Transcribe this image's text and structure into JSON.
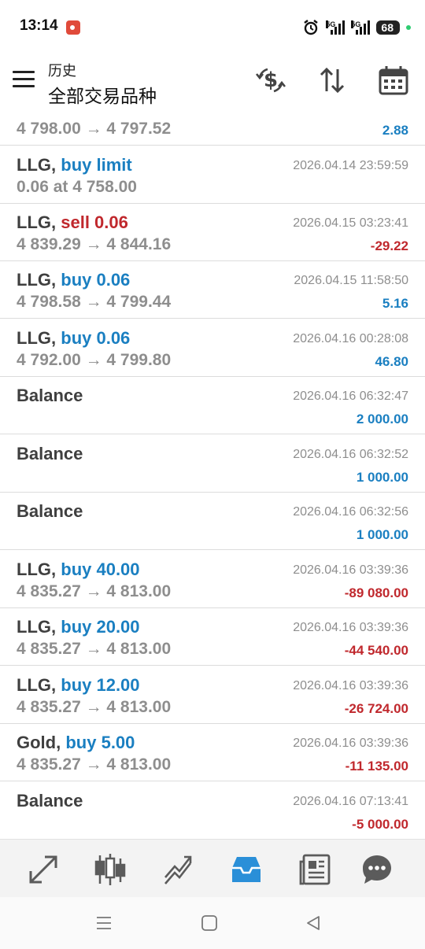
{
  "status": {
    "time": "13:14",
    "network1": "5G",
    "network2": "5G",
    "battery": "68"
  },
  "header": {
    "subtitle": "历史",
    "title": "全部交易品种"
  },
  "rows": [
    {
      "l1_symbol": "",
      "l1_sep": "",
      "l1_action": "",
      "l2": "4 798.00 → 4 797.52",
      "r1": "",
      "r2": "2.88",
      "r2_color": "blue"
    },
    {
      "l1_symbol": "LLG",
      "l1_sep": ",",
      "l1_action": "buy limit",
      "action_color": "blue",
      "l2": "0.06 at 4 758.00",
      "r1": "2026.04.14 23:59:59",
      "r2": "",
      "r2_color": "blue"
    },
    {
      "l1_symbol": "LLG",
      "l1_sep": ",",
      "l1_action": "sell 0.06",
      "action_color": "red",
      "l2": "4 839.29 → 4 844.16",
      "r1": "2026.04.15 03:23:41",
      "r2": "-29.22",
      "r2_color": "red"
    },
    {
      "l1_symbol": "LLG",
      "l1_sep": ",",
      "l1_action": "buy 0.06",
      "action_color": "blue",
      "l2": "4 798.58 → 4 799.44",
      "r1": "2026.04.15 11:58:50",
      "r2": "5.16",
      "r2_color": "blue"
    },
    {
      "l1_symbol": "LLG",
      "l1_sep": ",",
      "l1_action": "buy 0.06",
      "action_color": "blue",
      "l2": "4 792.00 → 4 799.80",
      "r1": "2026.04.16 00:28:08",
      "r2": "46.80",
      "r2_color": "blue"
    },
    {
      "l1_symbol": "Balance",
      "l1_sep": "",
      "l1_action": "",
      "l2": "",
      "r1": "2026.04.16 06:32:47",
      "r2": "2 000.00",
      "r2_color": "blue"
    },
    {
      "l1_symbol": "Balance",
      "l1_sep": "",
      "l1_action": "",
      "l2": "",
      "r1": "2026.04.16 06:32:52",
      "r2": "1 000.00",
      "r2_color": "blue"
    },
    {
      "l1_symbol": "Balance",
      "l1_sep": "",
      "l1_action": "",
      "l2": "",
      "r1": "2026.04.16 06:32:56",
      "r2": "1 000.00",
      "r2_color": "blue"
    },
    {
      "l1_symbol": "LLG",
      "l1_sep": ",",
      "l1_action": "buy 40.00",
      "action_color": "blue",
      "l2": "4 835.27 → 4 813.00",
      "r1": "2026.04.16 03:39:36",
      "r2": "-89 080.00",
      "r2_color": "red"
    },
    {
      "l1_symbol": "LLG",
      "l1_sep": ",",
      "l1_action": "buy 20.00",
      "action_color": "blue",
      "l2": "4 835.27 → 4 813.00",
      "r1": "2026.04.16 03:39:36",
      "r2": "-44 540.00",
      "r2_color": "red"
    },
    {
      "l1_symbol": "LLG",
      "l1_sep": ",",
      "l1_action": "buy 12.00",
      "action_color": "blue",
      "l2": "4 835.27 → 4 813.00",
      "r1": "2026.04.16 03:39:36",
      "r2": "-26 724.00",
      "r2_color": "red"
    },
    {
      "l1_symbol": "Gold",
      "l1_sep": ",",
      "l1_action": "buy 5.00",
      "action_color": "blue",
      "l2": "4 835.27 → 4 813.00",
      "r1": "2026.04.16 03:39:36",
      "r2": "-11 135.00",
      "r2_color": "red"
    },
    {
      "l1_symbol": "Balance",
      "l1_sep": "",
      "l1_action": "",
      "l2": "",
      "r1": "2026.04.16 07:13:41",
      "r2": "-5 000.00",
      "r2_color": "red"
    }
  ],
  "colors": {
    "accent_blue": "#1a7fc1",
    "loss_red": "#c0282d",
    "active_nav": "#2a8fd8"
  },
  "nav": {
    "items": [
      "trade-icon",
      "chart-icon",
      "analytics-icon",
      "history-icon",
      "news-icon",
      "chat-icon"
    ],
    "active": "history-icon"
  }
}
